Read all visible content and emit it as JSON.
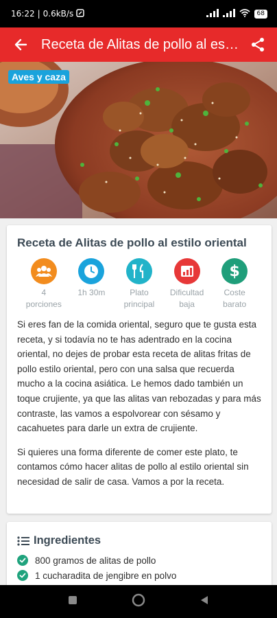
{
  "status_bar": {
    "time": "16:22",
    "speed": "0.6kB/s",
    "signal1": "signal",
    "signal2": "signal",
    "wifi": "wifi",
    "battery": "68"
  },
  "app_bar": {
    "title": "Receta de Alitas de pollo al estilo oriental",
    "back_icon": "arrow-back",
    "share_icon": "share"
  },
  "hero": {
    "badge": "Aves y caza"
  },
  "recipe": {
    "title": "Receta de Alitas de pollo al estilo oriental",
    "stats": [
      {
        "icon": "people-icon",
        "color": "#f28c1e",
        "line1": "4",
        "line2": "porciones"
      },
      {
        "icon": "clock-icon",
        "color": "#1aa3dc",
        "line1": "1h 30m",
        "line2": ""
      },
      {
        "icon": "cutlery-icon",
        "color": "#21b3c9",
        "line1": "Plato",
        "line2": "principal"
      },
      {
        "icon": "bar-chart-icon",
        "color": "#e73838",
        "line1": "Dificultad",
        "line2": "baja"
      },
      {
        "icon": "dollar-icon",
        "color": "#1f9e7a",
        "line1": "Coste",
        "line2": "barato"
      }
    ],
    "paragraphs": [
      "Si eres fan de la comida oriental, seguro que te gusta esta receta, y si todavía no te has adentrado en la cocina oriental, no dejes de probar esta receta de alitas fritas de pollo estilo oriental, pero con una salsa que recuerda mucho a la cocina asiática. Le hemos dado también un toque crujiente, ya que las alitas van rebozadas y para más contraste, las vamos a espolvorear con sésamo y cacahuetes para darle un extra de crujiente.",
      "Si quieres una forma diferente de comer este plato, te contamos cómo hacer alitas de pollo al estilo oriental sin necesidad de salir de casa. Vamos a por la receta."
    ]
  },
  "ingredients": {
    "title": "Ingredientes",
    "items": [
      "800 gramos de alitas de pollo",
      "1 cucharadita de jengibre en polvo"
    ]
  },
  "colors": {
    "app_bar": "#e72a2a",
    "badge": "#1aa3dc",
    "check": "#1fa37d"
  }
}
